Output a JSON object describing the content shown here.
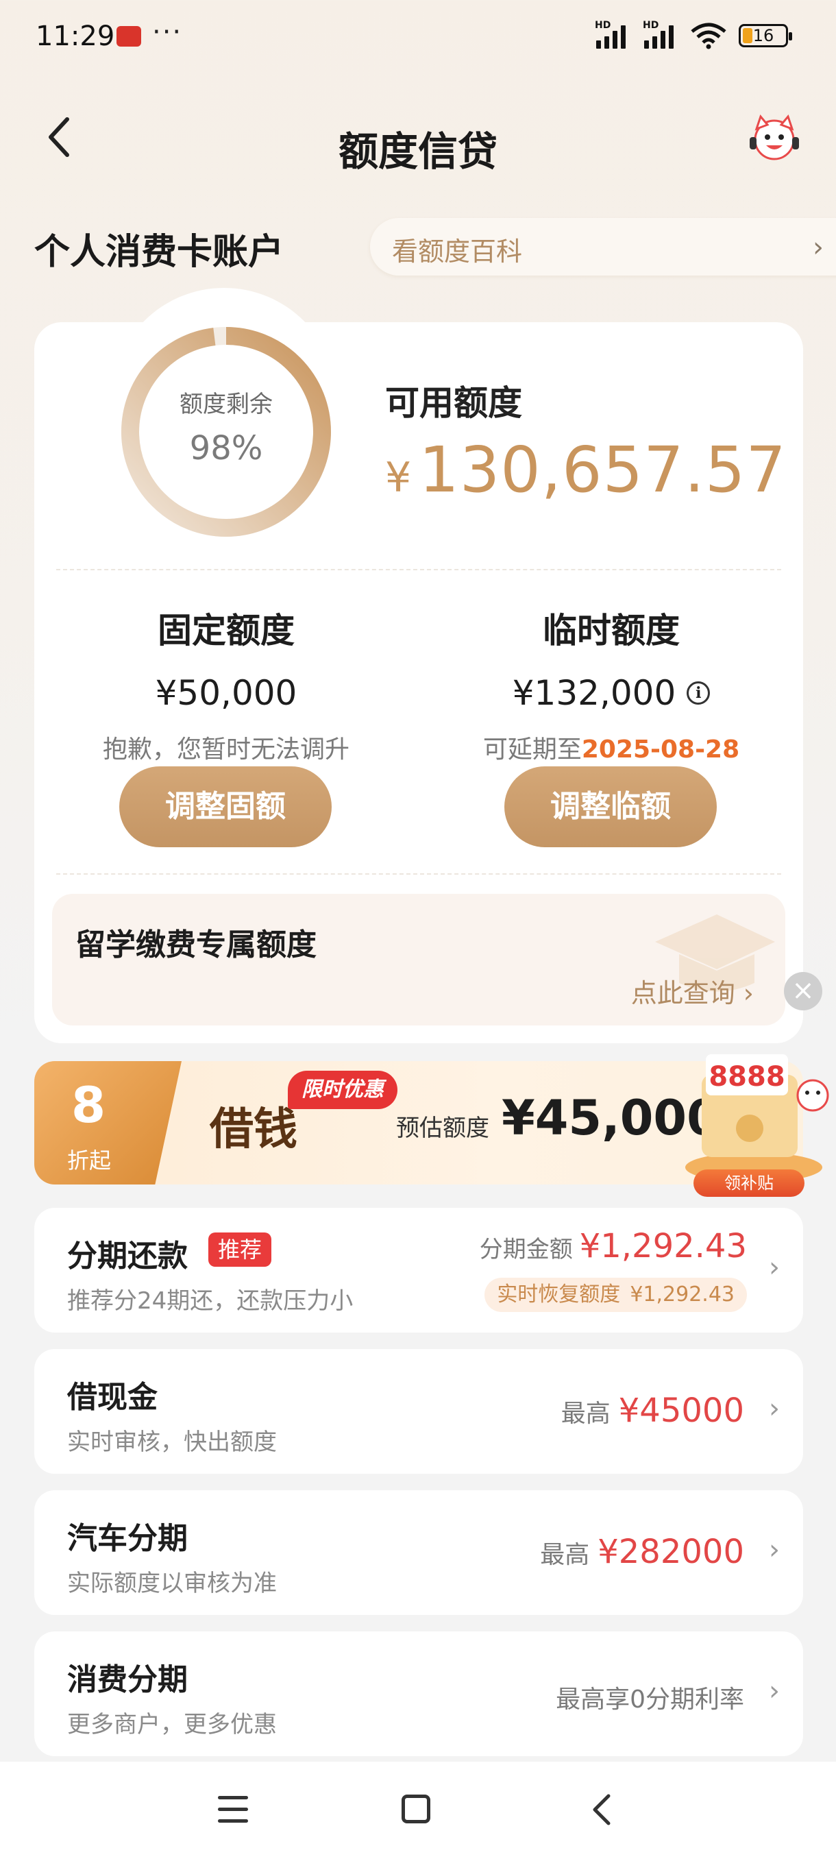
{
  "status_bar": {
    "time": "11:29",
    "more": "···",
    "battery": "16"
  },
  "header": {
    "title": "额度信贷"
  },
  "account": {
    "title": "个人消费卡账户",
    "wiki_link": "看额度百科",
    "chevron": "›"
  },
  "ring": {
    "label": "额度剩余",
    "value": "98%",
    "fraction": 0.98
  },
  "available": {
    "label": "可用额度",
    "currency": "¥",
    "amount": "130,657.57"
  },
  "fixed_quota": {
    "title": "固定额度",
    "amount": "¥50,000",
    "note": "抱歉，您暂时无法调升",
    "button": "调整固额"
  },
  "temp_quota": {
    "title": "临时额度",
    "amount": "¥132,000",
    "note_prefix": "可延期至",
    "note_date": "2025-08-28",
    "button": "调整临额"
  },
  "study_abroad": {
    "title": "留学缴费专属额度",
    "link": "点此查询 ›",
    "close": "×"
  },
  "banner": {
    "discount": "8",
    "discount_unit": "折起",
    "title": "借钱",
    "tag": "限时优惠",
    "estimate_label": "预估额度",
    "estimate_amount": "¥45,000",
    "gift_amount": "8888",
    "gift_button": "领补贴"
  },
  "list": [
    {
      "title": "分期还款",
      "tag": "推荐",
      "subtitle": "推荐分24期还，还款压力小",
      "right_label": "分期金额",
      "right_amount": "¥1,292.43",
      "recover_label": "实时恢复额度",
      "recover_amount": "¥1,292.43"
    },
    {
      "title": "借现金",
      "subtitle": "实时审核，快出额度",
      "right_label": "最高",
      "right_amount": "¥45000"
    },
    {
      "title": "汽车分期",
      "subtitle": "实际额度以审核为准",
      "right_label": "最高",
      "right_amount": "¥282000"
    },
    {
      "title": "消费分期",
      "subtitle": "更多商户，更多优惠",
      "right_label": "最高享0分期利率"
    }
  ],
  "colors": {
    "accent": "#c9955d",
    "red": "#e24646",
    "orange_date": "#ea6d2a"
  }
}
